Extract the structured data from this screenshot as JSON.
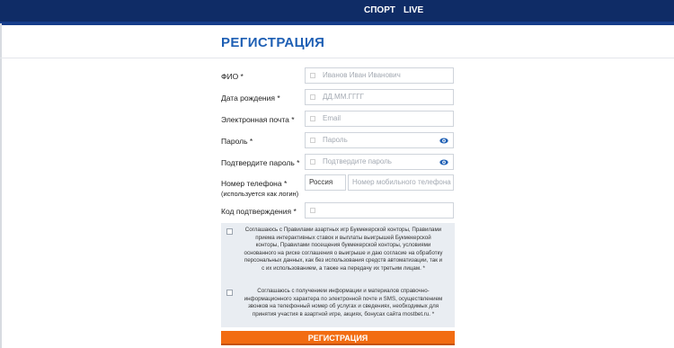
{
  "header": {
    "nav_sport": "СПОРТ",
    "nav_live": "LIVE"
  },
  "page_title": "РЕГИСТРАЦИЯ",
  "form": {
    "fio_label": "ФИО *",
    "fio_placeholder": "Иванов Иван Иванович",
    "dob_label": "Дата рождения *",
    "dob_placeholder": "ДД.ММ.ГГГГ",
    "email_label": "Электронная почта *",
    "email_placeholder": "Email",
    "password_label": "Пароль *",
    "password_placeholder": "Пароль",
    "confirm_label": "Подтвердите пароль *",
    "confirm_placeholder": "Подтвердите пароль",
    "phone_label": "Номер телефона *",
    "phone_sublabel": "(используется как логин)",
    "country_value": "Россия",
    "phone_placeholder": "Номер мобильного телефона",
    "code_label": "Код подтверждения *"
  },
  "consent": {
    "rules_line1": "Соглашаюсь с Правилами азартных игр Букмекерской конторы, Правилами",
    "rules_line2": "приема интерактивных ставок и выплаты выигрышей Букмекерской",
    "rules_line3": "конторы, Правилами посещения букмекерской конторы, условиями",
    "rules_line4": "основанного на риске соглашения о выигрыше и даю согласие на обработку",
    "rules_line5": "персональных данных, как без использования средств автоматизации, так и",
    "rules_line6": "с их использованием, а также на передачу их третьим лицам. *",
    "info_line1": "Соглашаюсь с получением информации и материалов справочно-",
    "info_line2": "информационного характера по электронной почте и SMS, осуществлением",
    "info_line3": "звонков на телефонный номер об услугах и сведениях, необходимых для",
    "info_line4": "принятия участия в азартной игре, акциях, бонусах сайта mostbet.ru. *"
  },
  "submit_label": "РЕГИСТРАЦИЯ",
  "colors": {
    "header_bg": "#0f2c66",
    "title": "#1e5fb4",
    "submit_bg": "#f26c12",
    "eye_icon": "#1e5fb4",
    "consent_bg": "#e9edf2"
  }
}
